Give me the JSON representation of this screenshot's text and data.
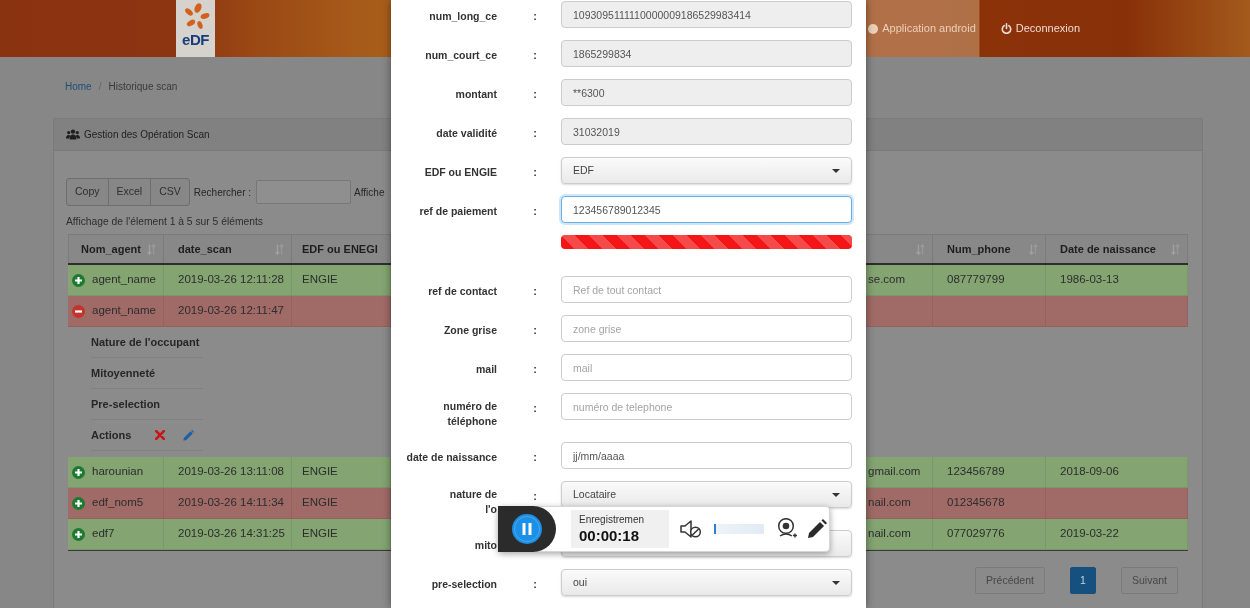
{
  "header": {
    "logo": {
      "text": "eDF"
    },
    "nav": [
      {
        "label": "Application android",
        "kind": "app"
      },
      {
        "label": "Deconnexion",
        "kind": "logout"
      }
    ]
  },
  "breadcrumb": {
    "items": [
      {
        "label": "Home",
        "link": true
      },
      {
        "label": "Historique scan",
        "link": false
      }
    ],
    "separator": "/"
  },
  "panel": {
    "title": "Gestion des Opération Scan",
    "buttons": [
      "Copy",
      "Excel",
      "CSV"
    ],
    "search_label": "Rechercher :",
    "length_label": "Affiche",
    "info": "Affichage de l'élement 1 à 5 sur 5 éléments"
  },
  "table": {
    "columns": [
      {
        "label": "Nom_agent",
        "sortable": true
      },
      {
        "label": "date_scan",
        "sortable": true
      },
      {
        "label": "EDF ou ENEGI",
        "sortable": false
      },
      {
        "sortable": true
      },
      {
        "label": "Num_phone",
        "sortable": true
      },
      {
        "label": "Date de naissance",
        "sortable": true
      }
    ],
    "rows": [
      {
        "cells": [
          "agent_name",
          "2019-03-26 12:11:28",
          "ENGIE",
          "se.com",
          "087779799",
          "1986-03-13"
        ],
        "color": "#84a472",
        "expanded": false
      },
      {
        "cells": [
          "agent_name",
          "2019-03-26 12:11:47",
          null,
          null,
          null,
          null
        ],
        "color": "#a06b67",
        "expanded": true,
        "details": [
          {
            "label": "Nature de l'occupant",
            "kind": "field"
          },
          {
            "label": "Mitoyenneté",
            "kind": "field"
          },
          {
            "label": "Pre-selection",
            "kind": "field"
          },
          {
            "label": "Actions",
            "kind": "actions"
          }
        ]
      },
      {
        "cells": [
          "harounian",
          "2019-03-26 13:11:08",
          "ENGIE",
          "gmail.com",
          "123456789",
          "2018-09-06"
        ],
        "color": "#84a472",
        "expanded": false
      },
      {
        "cells": [
          "edf_nom5",
          "2019-03-26 14:11:34",
          "ENGIE",
          "nail.com",
          "012345678",
          null
        ],
        "color": "#a06b67",
        "expanded": false
      },
      {
        "cells": [
          "edf7",
          "2019-03-26 14:31:25",
          "ENGIE",
          "nail.com",
          "077029776",
          "2019-03-22"
        ],
        "color": "#84a472",
        "expanded": false
      }
    ]
  },
  "pagination": {
    "previous": "Précédent",
    "pages": [
      {
        "label": "1",
        "selected": true
      }
    ],
    "next": "Suivant"
  },
  "dialog": {
    "fields": [
      {
        "label": "num_long_ce",
        "colon": ":",
        "kind": "readonly",
        "value": "1093095111110000009186529983414"
      },
      {
        "label": "num_court_ce",
        "colon": ":",
        "kind": "readonly",
        "value": "1865299834"
      },
      {
        "label": "montant",
        "colon": ":",
        "kind": "readonly",
        "value": "**6300"
      },
      {
        "label": "date validité",
        "colon": ":",
        "kind": "readonly",
        "value": "31032019"
      },
      {
        "label": "EDF ou ENGIE",
        "colon": ":",
        "kind": "select",
        "value": "EDF"
      },
      {
        "label": "ref de paiement",
        "colon": ":",
        "kind": "input",
        "value": "123456789012345",
        "focused": true
      },
      {
        "kind": "progress",
        "level": 1
      },
      {
        "label": "ref de contact",
        "colon": ":",
        "kind": "input",
        "placeholder": "Ref de tout contact",
        "focused": false
      },
      {
        "label": "Zone grise",
        "colon": ":",
        "kind": "input",
        "placeholder": "zone grise",
        "focused": false
      },
      {
        "label": "mail",
        "colon": ":",
        "kind": "input",
        "placeholder": "mail",
        "focused": false
      },
      {
        "label": "numéro de téléphone",
        "colon": ":",
        "kind": "input",
        "placeholder": "numéro de telephone",
        "focused": false
      },
      {
        "label": "date de naissance",
        "colon": ":",
        "kind": "date",
        "placeholder": "jj/mm/aaaa"
      },
      {
        "label": "nature de\nl'o",
        "colon": ":",
        "kind": "select",
        "value": "Locataire"
      },
      {
        "label": "mito",
        "kind": "select"
      },
      {
        "label": "pre-selection",
        "colon": ":",
        "kind": "select",
        "value": "oui"
      }
    ]
  },
  "recorder": {
    "recording": true,
    "title": "Enregistremen",
    "time": "00:00:18",
    "muted": true,
    "volume": {
      "level": 0
    }
  }
}
